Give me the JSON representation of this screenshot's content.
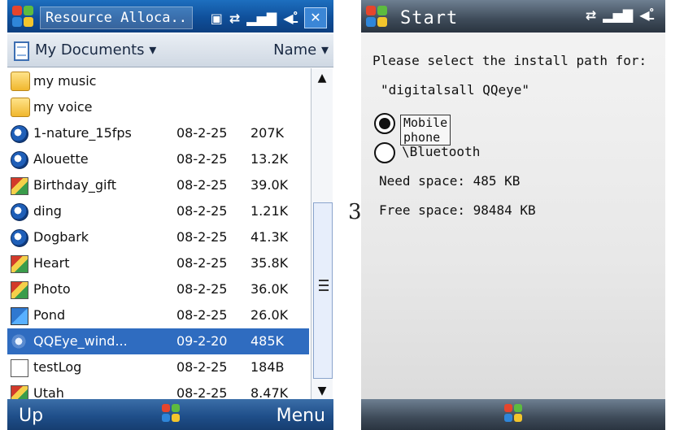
{
  "left": {
    "title": "Resource Alloca..",
    "toolbar": {
      "folder": "My Documents ▾",
      "sort": "Name ▾"
    },
    "files": [
      {
        "name": "my music",
        "date": "",
        "size": "",
        "icon": "folder-icon"
      },
      {
        "name": "my voice",
        "date": "",
        "size": "",
        "icon": "folder-icon"
      },
      {
        "name": "1-nature_15fps",
        "date": "08-2-25",
        "size": "207K",
        "icon": "media-icon"
      },
      {
        "name": "Alouette",
        "date": "08-2-25",
        "size": "13.2K",
        "icon": "media-icon"
      },
      {
        "name": "Birthday_gift",
        "date": "08-2-25",
        "size": "39.0K",
        "icon": "image-icon"
      },
      {
        "name": "ding",
        "date": "08-2-25",
        "size": "1.21K",
        "icon": "media-icon"
      },
      {
        "name": "Dogbark",
        "date": "08-2-25",
        "size": "41.3K",
        "icon": "media-icon"
      },
      {
        "name": "Heart",
        "date": "08-2-25",
        "size": "35.8K",
        "icon": "image-icon"
      },
      {
        "name": "Photo",
        "date": "08-2-25",
        "size": "36.0K",
        "icon": "image-icon"
      },
      {
        "name": "Pond",
        "date": "08-2-25",
        "size": "26.0K",
        "icon": "image-icon"
      },
      {
        "name": "QQEye_wind...",
        "date": "09-2-20",
        "size": "485K",
        "icon": "app-icon",
        "selected": true
      },
      {
        "name": "testLog",
        "date": "08-2-25",
        "size": "184B",
        "icon": "document-icon"
      },
      {
        "name": "Utah",
        "date": "08-2-25",
        "size": "8.47K",
        "icon": "image-icon"
      }
    ],
    "softkeys": {
      "left": "Up",
      "right": "Menu"
    }
  },
  "right": {
    "title": "Start",
    "prompt_line1": "Please select the install path for:",
    "prompt_line2": "\"digitalsall QQeye\"",
    "options": [
      {
        "label": "Mobile phone",
        "selected": true
      },
      {
        "label": "\\Bluetooth",
        "selected": false
      }
    ],
    "need_space": "Need space: 485 KB",
    "free_space": "Free space: 98484 KB"
  },
  "annotation": "3",
  "colors": {
    "titlebar": "#0f4f9a",
    "selection": "#2f6cc0",
    "softbar": "#1f4f8a"
  }
}
